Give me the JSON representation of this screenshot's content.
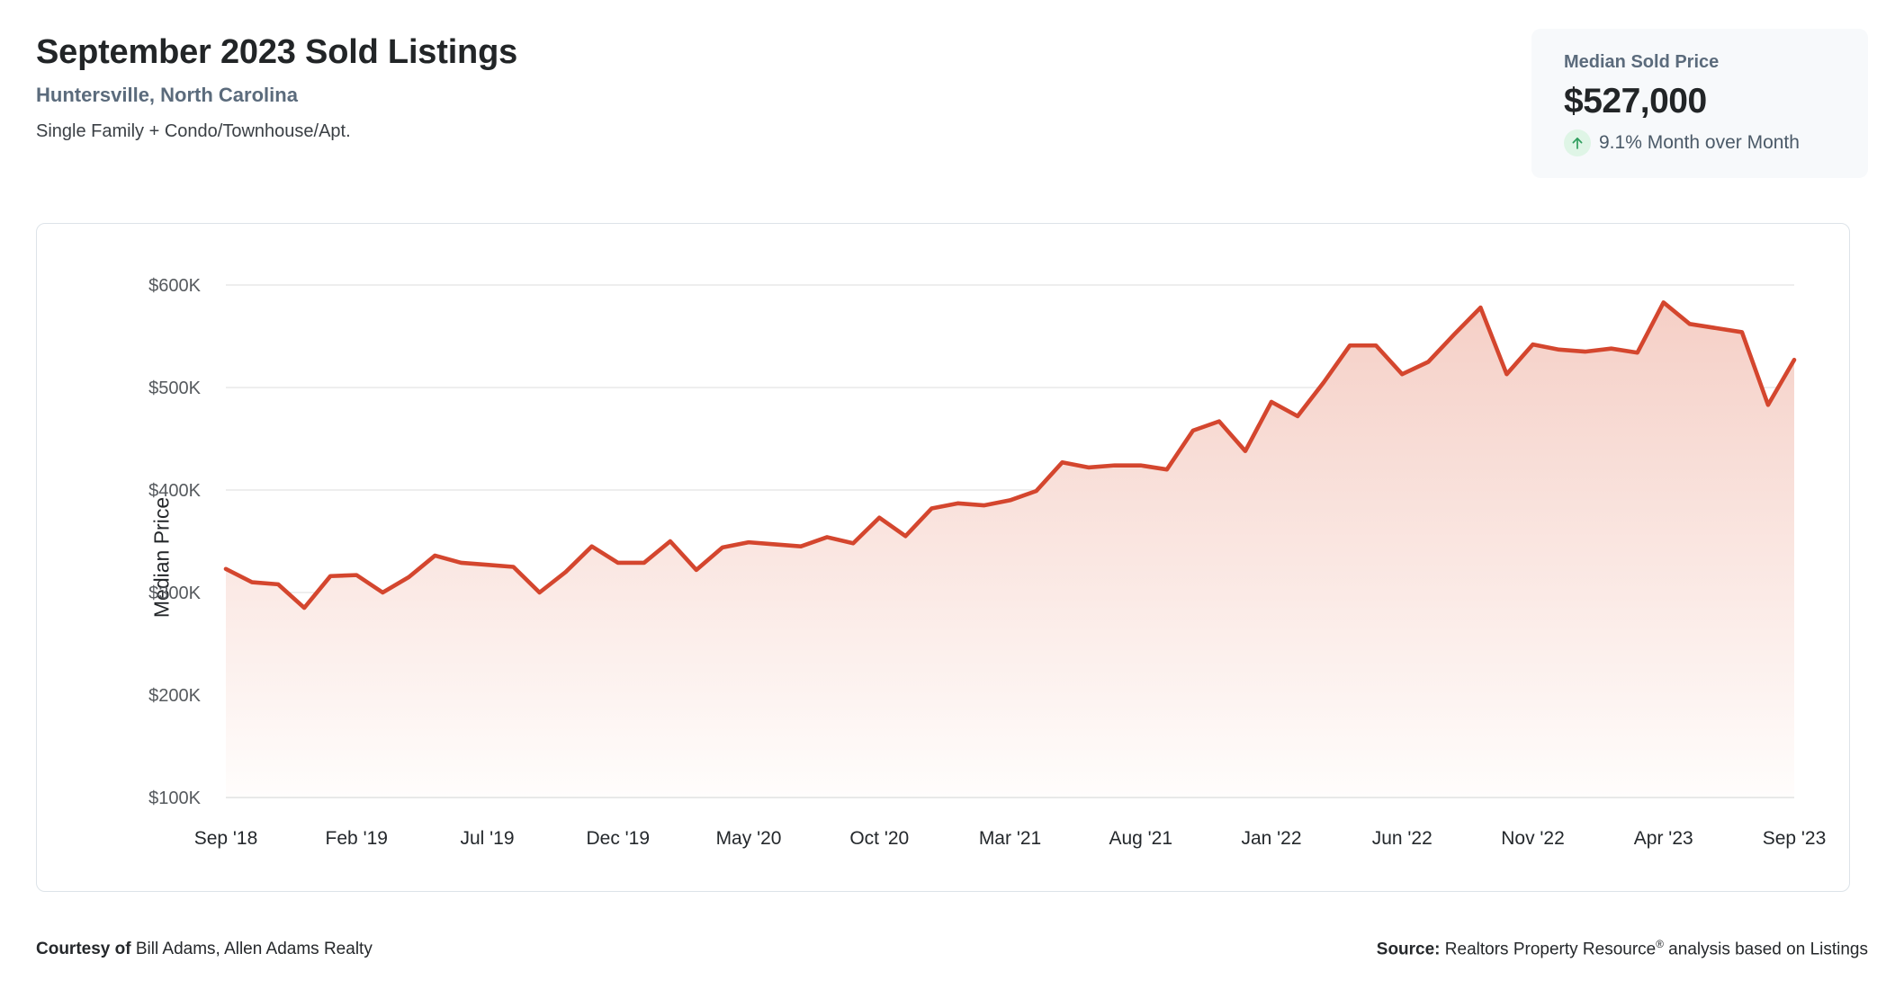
{
  "header": {
    "title": "September 2023 Sold Listings",
    "location": "Huntersville, North Carolina",
    "property_types": "Single Family + Condo/Townhouse/Apt."
  },
  "stat_card": {
    "label": "Median Sold Price",
    "value": "$527,000",
    "change_text": "9.1% Month over Month",
    "direction": "up",
    "arrow_icon": "arrow-up-icon",
    "accent_color": "#2f9e5e",
    "badge_bg": "#dff5e6",
    "card_bg": "#f7f9fb"
  },
  "footer": {
    "courtesy_label": "Courtesy of",
    "courtesy_value": "Bill Adams, Allen Adams Realty",
    "source_label": "Source:",
    "source_value_pre": "Realtors Property Resource",
    "source_registered": "®",
    "source_value_post": " analysis based on Listings"
  },
  "chart_data": {
    "type": "area",
    "title": "",
    "xlabel": "",
    "ylabel": "Median Price",
    "ylim": [
      100000,
      600000
    ],
    "ytick_labels": [
      "$600K",
      "$500K",
      "$400K",
      "$300K",
      "$200K",
      "$100K"
    ],
    "ytick_values": [
      600000,
      500000,
      400000,
      300000,
      200000,
      100000
    ],
    "xtick_labels": [
      "Sep '18",
      "Feb '19",
      "Jul '19",
      "Dec '19",
      "May '20",
      "Oct '20",
      "Mar '21",
      "Aug '21",
      "Jan '22",
      "Jun '22",
      "Nov '22",
      "Apr '23",
      "Sep '23"
    ],
    "xtick_indices": [
      0,
      5,
      10,
      15,
      20,
      25,
      30,
      35,
      40,
      45,
      50,
      55,
      60
    ],
    "grid": true,
    "legend": "none",
    "line_color": "#d4462e",
    "fill_top_color": "#f5cfc6",
    "fill_bottom_color": "#fffdfc",
    "grid_color": "#e8e8e8",
    "series": [
      {
        "name": "Median Price",
        "x": [
          "Sep '18",
          "Oct '18",
          "Nov '18",
          "Dec '18",
          "Jan '19",
          "Feb '19",
          "Mar '19",
          "Apr '19",
          "May '19",
          "Jun '19",
          "Jul '19",
          "Aug '19",
          "Sep '19",
          "Oct '19",
          "Nov '19",
          "Dec '19",
          "Jan '20",
          "Feb '20",
          "Mar '20",
          "Apr '20",
          "May '20",
          "Jun '20",
          "Jul '20",
          "Aug '20",
          "Sep '20",
          "Oct '20",
          "Nov '20",
          "Dec '20",
          "Jan '21",
          "Feb '21",
          "Mar '21",
          "Apr '21",
          "May '21",
          "Jun '21",
          "Jul '21",
          "Aug '21",
          "Sep '21",
          "Oct '21",
          "Nov '21",
          "Dec '21",
          "Jan '22",
          "Feb '22",
          "Mar '22",
          "Apr '22",
          "May '22",
          "Jun '22",
          "Jul '22",
          "Aug '22",
          "Sep '22",
          "Oct '22",
          "Nov '22",
          "Dec '22",
          "Jan '23",
          "Feb '23",
          "Mar '23",
          "Apr '23",
          "May '23",
          "Jun '23",
          "Jul '23",
          "Aug '23",
          "Sep '23"
        ],
        "values": [
          323000,
          310000,
          308000,
          285000,
          316000,
          317000,
          300000,
          315000,
          336000,
          329000,
          327000,
          325000,
          300000,
          320000,
          345000,
          329000,
          329000,
          350000,
          322000,
          344000,
          349000,
          347000,
          345000,
          354000,
          348000,
          373000,
          355000,
          382000,
          387000,
          385000,
          390000,
          399000,
          427000,
          422000,
          424000,
          424000,
          420000,
          458000,
          467000,
          438000,
          486000,
          472000,
          505000,
          541000,
          541000,
          513000,
          525000,
          552000,
          578000,
          513000,
          542000,
          537000,
          535000,
          538000,
          534000,
          583000,
          562000,
          558000,
          554000,
          483000,
          527000
        ]
      }
    ]
  }
}
